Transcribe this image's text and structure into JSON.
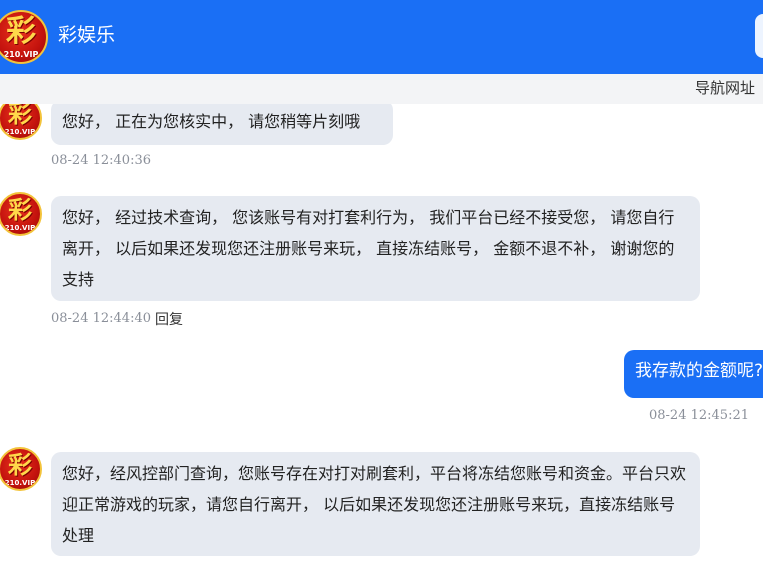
{
  "header": {
    "logo_glyph": "彩",
    "logo_text": "210.VIP",
    "title": "彩娱乐"
  },
  "navbar": {
    "link": "导航网址"
  },
  "messages": [
    {
      "sender": "agent",
      "text": "您好， 正在为您核实中， 请您稍等片刻哦",
      "time": "08-24 12:40:36"
    },
    {
      "sender": "agent",
      "text": "您好， 经过技术查询， 您该账号有对打套利行为， 我们平台已经不接受您， 请您自行离开， 以后如果还发现您还注册账号来玩， 直接冻结账号， 金额不退不补， 谢谢您的支持",
      "time": "08-24 12:44:40",
      "reply_label": "回复"
    },
    {
      "sender": "user",
      "text": "我存款的金额呢?",
      "time": "08-24 12:45:21"
    },
    {
      "sender": "agent",
      "text": "您好，经风控部门查询，您账号存在对打对刷套利，平台将冻结您账号和资金。平台只欢迎正常游戏的玩家，请您自行离开， 以后如果还发现您还注册账号来玩，直接冻结账号处理"
    }
  ],
  "colors": {
    "brand_blue": "#1a6ff5",
    "agent_bubble": "#e6eaf1",
    "timestamp": "#8a8f99"
  },
  "icons": {
    "logo": "caiyule-logo",
    "avatar": "agent-avatar"
  }
}
